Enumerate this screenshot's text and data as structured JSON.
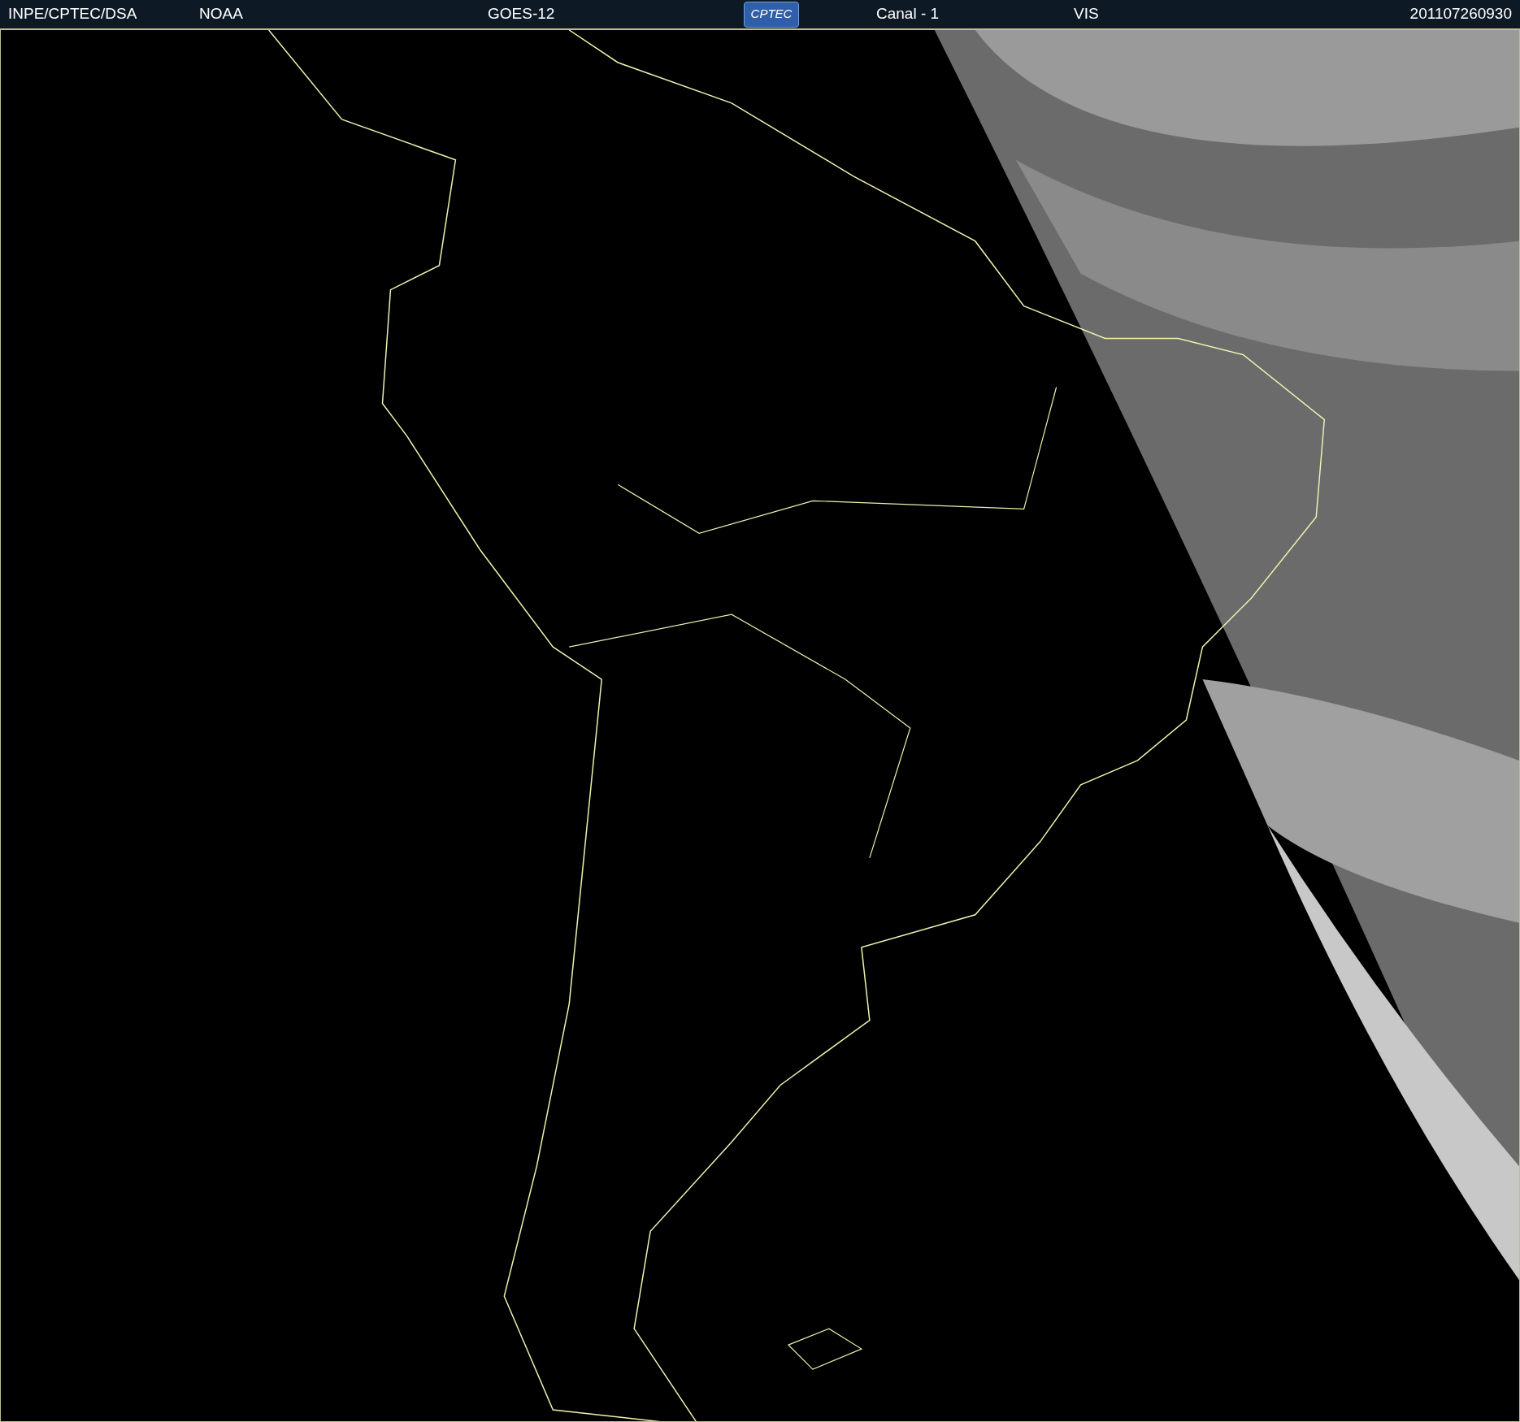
{
  "header": {
    "source": "INPE/CPTEC/DSA",
    "agency": "NOAA",
    "satellite": "GOES-12",
    "logo_text": "CPTEC",
    "channel": "Canal - 1",
    "band": "VIS",
    "timestamp": "201107260930"
  }
}
